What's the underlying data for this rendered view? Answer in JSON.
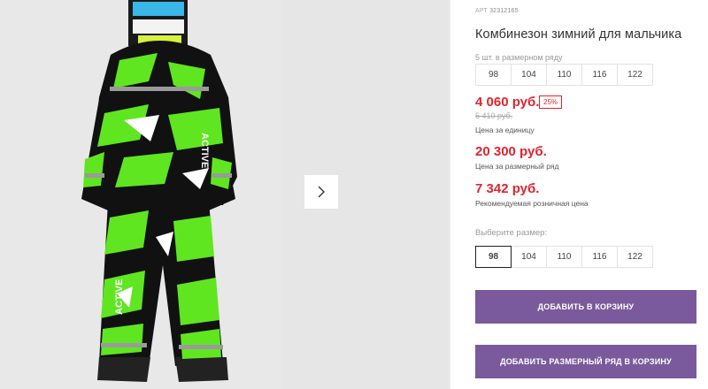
{
  "product": {
    "article_label": "АРТ",
    "article_number": "32312165",
    "title": "Комбинезон зимний для мальчика",
    "row_label": "5 шт. в размерном ряду",
    "sizes": [
      "98",
      "104",
      "110",
      "116",
      "122"
    ],
    "price": "4 060 руб.",
    "discount": "25%",
    "old_price": "5 410 руб.",
    "unit_label": "Цена за единицу",
    "row_price": "20 300 руб.",
    "row_price_label": "Цена за размерный ряд",
    "rrp_price": "7 342 руб.",
    "rrp_label": "Рекомендуемая розничная цена",
    "choose_size_label": "Выберите размер:",
    "selected_size": "98"
  },
  "actions": {
    "add_to_cart": "ДОБАВИТЬ В КОРЗИНУ",
    "add_row_to_cart": "ДОБАВИТЬ РАЗМЕРНЫЙ РЯД В КОРЗИНУ"
  },
  "gallery": {
    "next_icon": "chevron-right-icon",
    "photo_print_text": "ACTIVE"
  },
  "colors": {
    "price_red": "#e0242f",
    "button_purple": "#7a5a9c",
    "suit_green": "#5fe620"
  }
}
